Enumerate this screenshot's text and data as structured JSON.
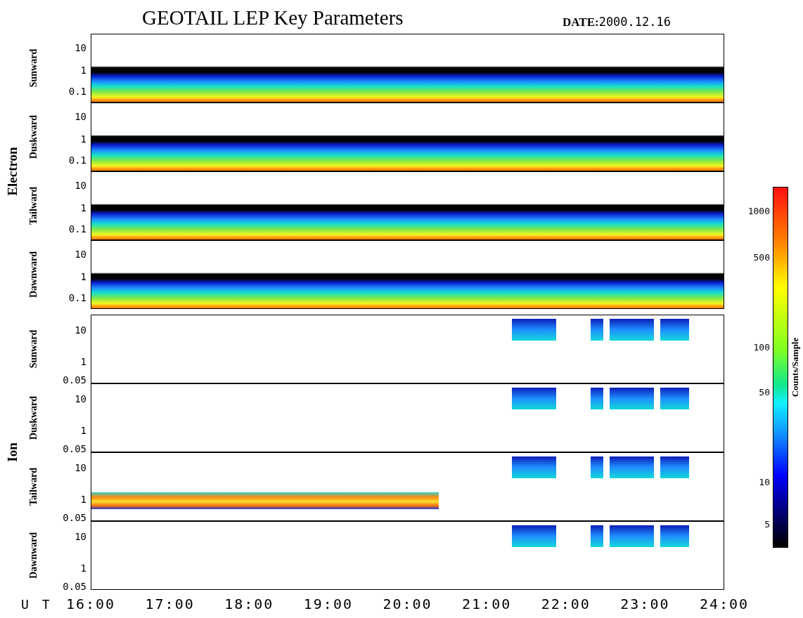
{
  "title": "GEOTAIL LEP Key Parameters",
  "date_label": "DATE:",
  "date": "2000.12.16",
  "groups": [
    {
      "name": "Electron",
      "kind": "electron",
      "panels": [
        {
          "label": "Sunward",
          "yticks": [
            "10",
            "1",
            "0.1"
          ]
        },
        {
          "label": "Duskward",
          "yticks": [
            "10",
            "1",
            "0.1"
          ]
        },
        {
          "label": "Tailward",
          "yticks": [
            "10",
            "1",
            "0.1"
          ]
        },
        {
          "label": "Dawnward",
          "yticks": [
            "10",
            "1",
            "0.1"
          ]
        }
      ]
    },
    {
      "name": "Ion",
      "kind": "ion",
      "panels": [
        {
          "label": "Sunward",
          "yticks": [
            "10",
            "1",
            "0.05"
          ]
        },
        {
          "label": "Duskward",
          "yticks": [
            "10",
            "1",
            "0.05"
          ]
        },
        {
          "label": "Tailward",
          "yticks": [
            "10",
            "1",
            "0.05"
          ]
        },
        {
          "label": "Dawnward",
          "yticks": [
            "10",
            "1",
            "0.05"
          ]
        }
      ]
    }
  ],
  "x_axis": {
    "label": "U T",
    "ticks": [
      "16:00",
      "17:00",
      "18:00",
      "19:00",
      "20:00",
      "21:00",
      "22:00",
      "23:00",
      "24:00"
    ]
  },
  "colorbar": {
    "title": "Counts/Sample",
    "ticks": [
      "1000",
      "500",
      "100",
      "50",
      "10",
      "5"
    ]
  }
}
